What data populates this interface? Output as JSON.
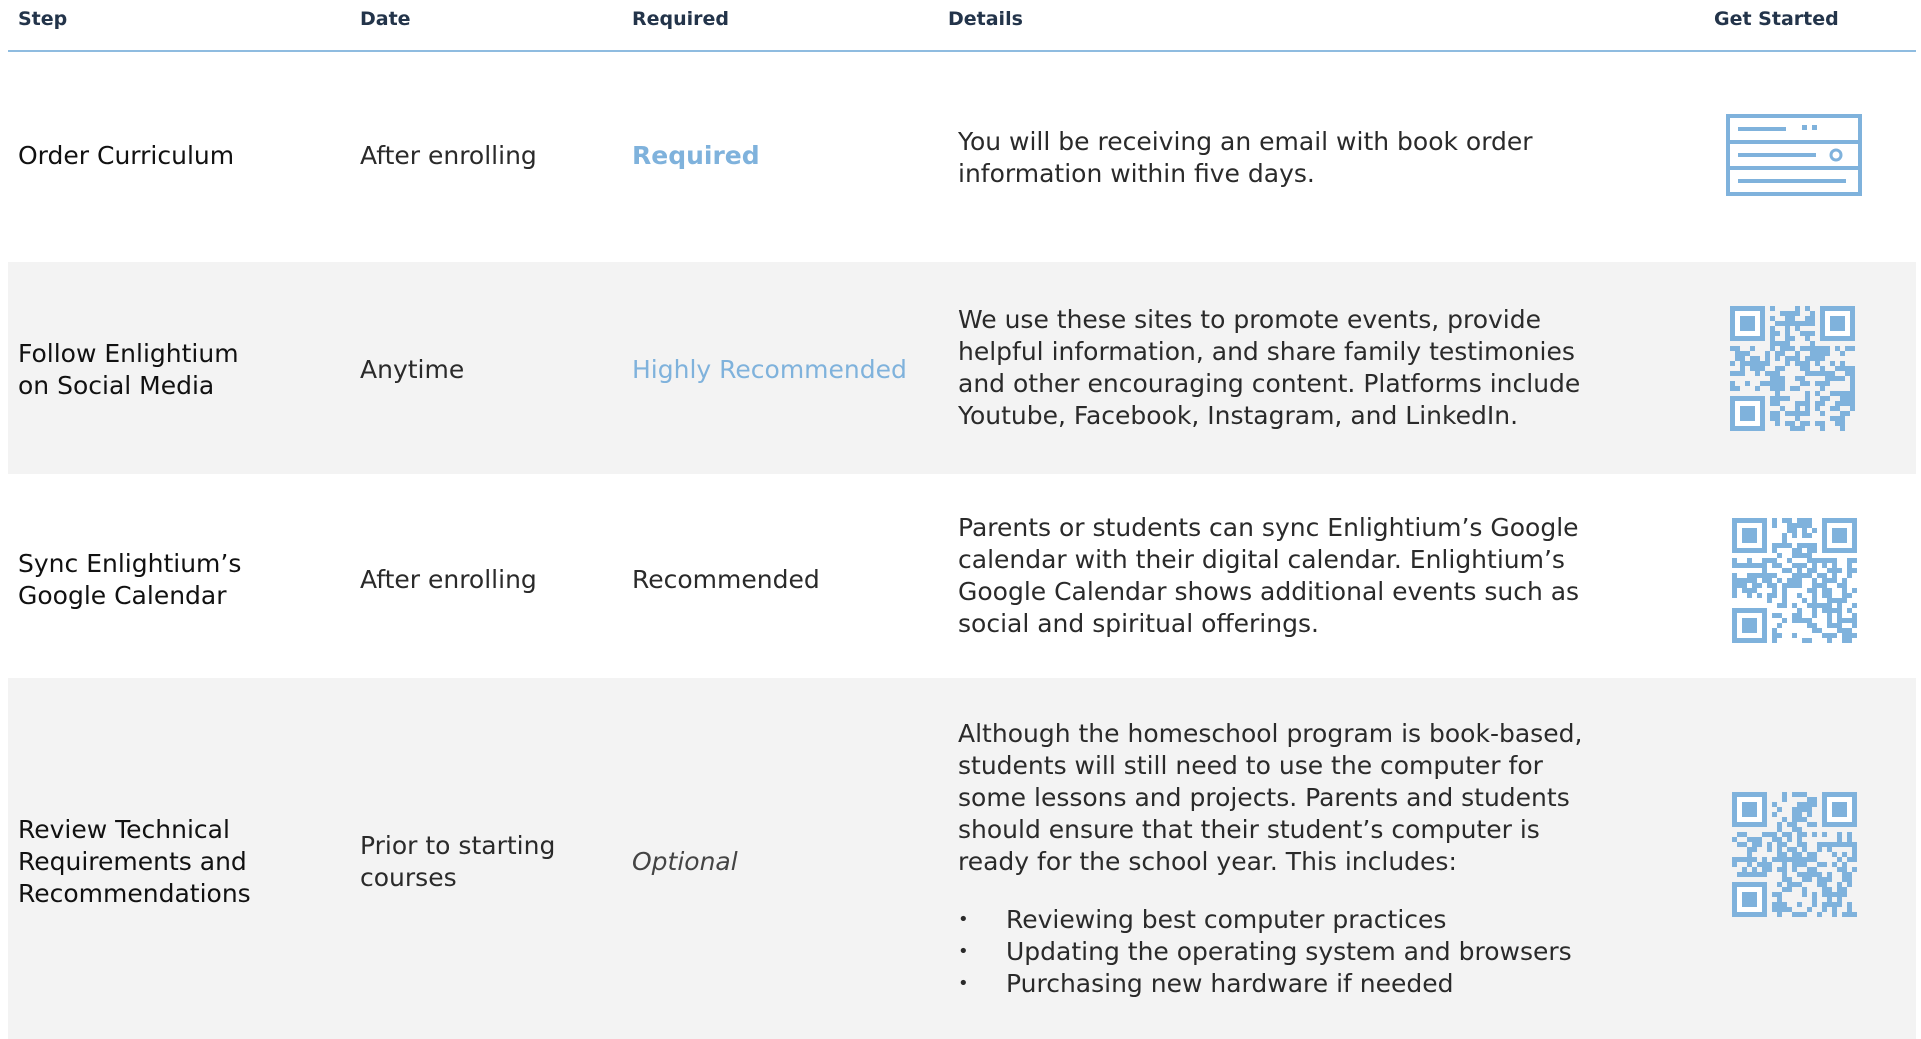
{
  "header": {
    "step": "Step",
    "date": "Date",
    "required": "Required",
    "details": "Details",
    "get_started": "Get Started"
  },
  "colors": {
    "accent": "#7fb2dc",
    "header_rule": "#8fbce0",
    "stripe": "#f3f3f3"
  },
  "rows": [
    {
      "step": "Order Curriculum",
      "date": "After enrolling",
      "required": "Required",
      "details": "You will be receiving an email with book order information within five days.",
      "icon": "server-rack-icon"
    },
    {
      "step": "Follow Enlightium on Social Media",
      "date": "Anytime",
      "required": "Highly Recommended",
      "details": "We use these sites to promote events, provide helpful information, and share family testimonies and other encouraging content. Platforms include Youtube, Facebook, Instagram, and LinkedIn.",
      "icon": "qr-code-icon"
    },
    {
      "step": "Sync Enlightium’s Google Calendar",
      "date": "After enrolling",
      "required": "Recommended",
      "details": "Parents or students can sync Enlightium’s Google calendar with their digital calendar. Enlightium’s Google Calendar shows additional events such as social and spiritual offerings.",
      "icon": "qr-code-icon"
    },
    {
      "step": "Review Technical Requirements and Recommendations",
      "date": "Prior to starting courses",
      "required": "Optional",
      "details": "Although the homeschool program is book-based, students will still need to use the computer for some lessons and projects. Parents and students should ensure that their student’s computer is ready for the school year. This includes:",
      "bullets": [
        "Reviewing best computer practices",
        "Updating the operating system and browsers",
        "Purchasing new hardware if needed"
      ],
      "icon": "qr-code-icon"
    }
  ]
}
